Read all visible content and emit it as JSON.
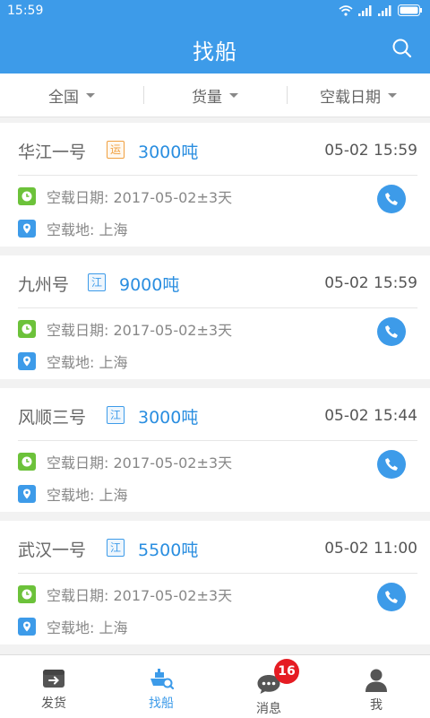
{
  "status": {
    "time": "15:59"
  },
  "header": {
    "title": "找船"
  },
  "filters": [
    {
      "label": "全国"
    },
    {
      "label": "货量"
    },
    {
      "label": "空载日期"
    }
  ],
  "ships": [
    {
      "name": "华江一号",
      "tag": "运",
      "tag_color": "#f0a040",
      "tonnage": "3000吨",
      "time": "05-02 15:59",
      "date_label": "空载日期:",
      "date": "2017-05-02±3天",
      "place_label": "空载地:",
      "place": "上海"
    },
    {
      "name": "九州号",
      "tag": "江",
      "tag_color": "#3d9be9",
      "tonnage": "9000吨",
      "time": "05-02 15:59",
      "date_label": "空载日期:",
      "date": "2017-05-02±3天",
      "place_label": "空载地:",
      "place": "上海"
    },
    {
      "name": "风顺三号",
      "tag": "江",
      "tag_color": "#3d9be9",
      "tonnage": "3000吨",
      "time": "05-02 15:44",
      "date_label": "空载日期:",
      "date": "2017-05-02±3天",
      "place_label": "空载地:",
      "place": "上海"
    },
    {
      "name": "武汉一号",
      "tag": "江",
      "tag_color": "#3d9be9",
      "tonnage": "5500吨",
      "time": "05-02 11:00",
      "date_label": "空载日期:",
      "date": "2017-05-02±3天",
      "place_label": "空载地:",
      "place": "上海"
    }
  ],
  "tabs": [
    {
      "label": "发货",
      "icon": "box-out-icon"
    },
    {
      "label": "找船",
      "icon": "ship-search-icon",
      "active": true
    },
    {
      "label": "消息",
      "icon": "chat-icon",
      "badge": "16"
    },
    {
      "label": "我",
      "icon": "user-icon"
    }
  ],
  "colors": {
    "primary": "#3d9be9",
    "badge": "#e51c23",
    "clock_icon": "#6cc23a",
    "location_icon": "#3d9be9"
  }
}
